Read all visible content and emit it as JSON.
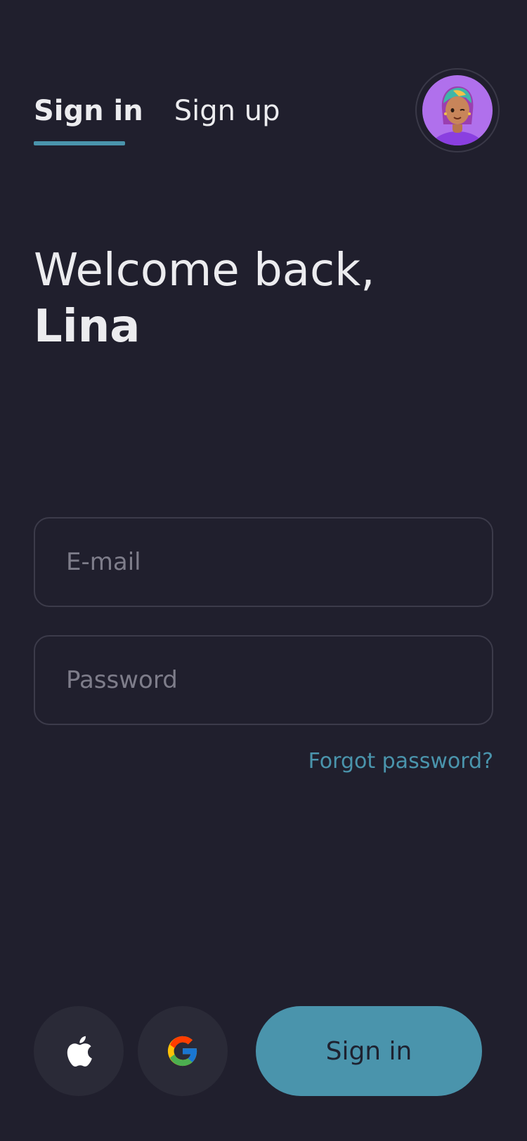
{
  "tabs": [
    {
      "label": "Sign in",
      "active": true
    },
    {
      "label": "Sign up",
      "active": false
    }
  ],
  "greeting": {
    "line1": "Welcome back,",
    "name": "Lina"
  },
  "form": {
    "email_placeholder": "E-mail",
    "password_placeholder": "Password",
    "forgot_label": "Forgot password?"
  },
  "actions": {
    "apple_icon": "apple-icon",
    "google_icon": "google-icon",
    "signin_label": "Sign in"
  },
  "colors": {
    "background": "#201F2D",
    "accent": "#4A94AC",
    "avatar_bg": "#B070EC",
    "social_bg": "#2A2A37",
    "placeholder": "#7E7D8A"
  }
}
